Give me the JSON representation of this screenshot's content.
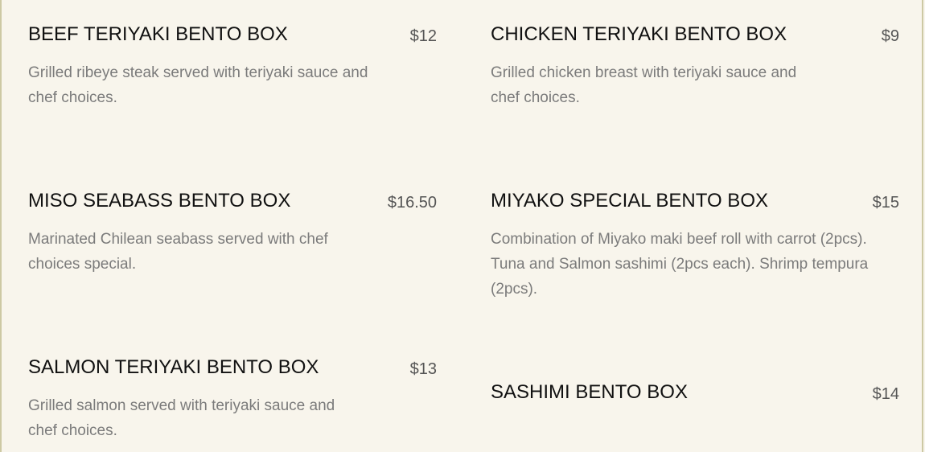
{
  "menu": {
    "items": [
      {
        "name": "BEEF TERIYAKI BENTO BOX",
        "price": "$12",
        "description": "Grilled ribeye steak served with teriyaki sauce and chef choices."
      },
      {
        "name": "CHICKEN TERIYAKI BENTO BOX",
        "price": "$9",
        "description": "Grilled chicken breast with teriyaki sauce and chef choices."
      },
      {
        "name": "MISO SEABASS BENTO BOX",
        "price": "$16.50",
        "description": "Marinated Chilean seabass served with chef choices special."
      },
      {
        "name": "MIYAKO SPECIAL BENTO BOX",
        "price": "$15",
        "description": "Combination of Miyako maki beef roll with carrot (2pcs). Tuna and Salmon sashimi (2pcs each). Shrimp tempura (2pcs)."
      },
      {
        "name": "SALMON TERIYAKI BENTO BOX",
        "price": "$13",
        "description": "Grilled salmon served with teriyaki sauce and chef choices."
      },
      {
        "name": "SASHIMI BENTO BOX",
        "price": "$14",
        "description": ""
      }
    ]
  }
}
